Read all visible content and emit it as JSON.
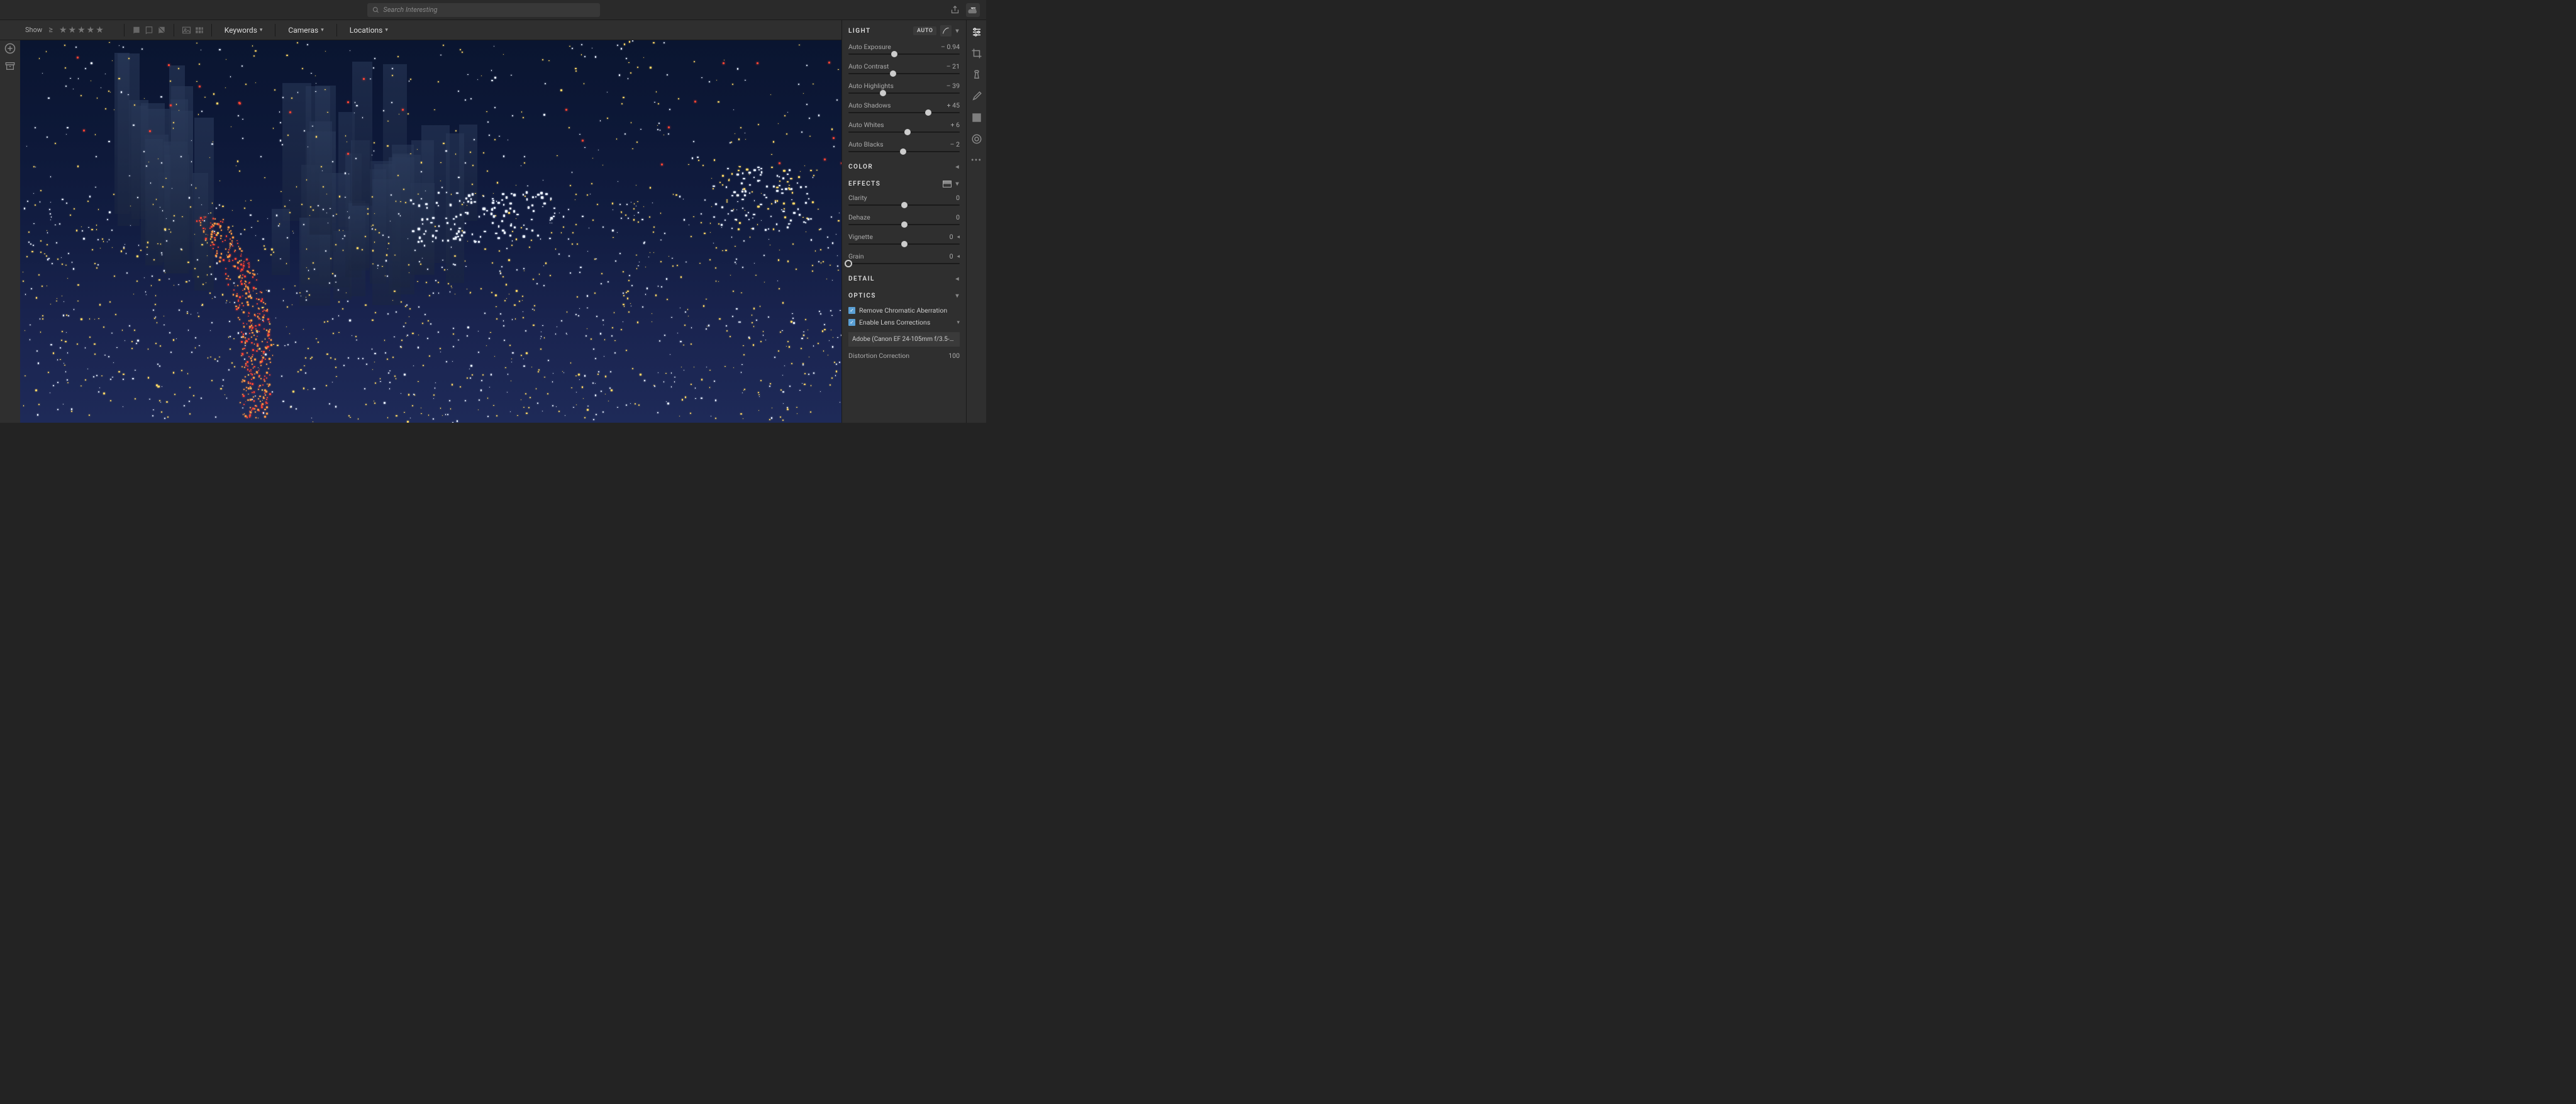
{
  "search": {
    "placeholder": "Search Interesting"
  },
  "filterbar": {
    "show_label": "Show",
    "dropdowns": {
      "keywords": "Keywords",
      "cameras": "Cameras",
      "locations": "Locations"
    }
  },
  "panels": {
    "light": {
      "title": "LIGHT",
      "auto_label": "AUTO",
      "sliders": [
        {
          "label": "Auto Exposure",
          "value": "– 0.94",
          "pos": 41
        },
        {
          "label": "Auto Contrast",
          "value": "– 21",
          "pos": 40
        },
        {
          "label": "Auto Highlights",
          "value": "– 39",
          "pos": 31
        },
        {
          "label": "Auto Shadows",
          "value": "+ 45",
          "pos": 72
        },
        {
          "label": "Auto Whites",
          "value": "+ 6",
          "pos": 53
        },
        {
          "label": "Auto Blacks",
          "value": "– 2",
          "pos": 49
        }
      ]
    },
    "color": {
      "title": "COLOR"
    },
    "effects": {
      "title": "EFFECTS",
      "sliders": [
        {
          "label": "Clarity",
          "value": "0",
          "pos": 50
        },
        {
          "label": "Dehaze",
          "value": "0",
          "pos": 50
        },
        {
          "label": "Vignette",
          "value": "0",
          "pos": 50,
          "expandable": true
        },
        {
          "label": "Grain",
          "value": "0",
          "pos": 0,
          "expandable": true,
          "big": true
        }
      ]
    },
    "detail": {
      "title": "DETAIL"
    },
    "optics": {
      "title": "OPTICS",
      "chromatic": "Remove Chromatic Aberration",
      "lens_corrections": "Enable Lens Corrections",
      "lens_profile": "Adobe (Canon EF 24-105mm f/3.5-5.…",
      "distortion_label": "Distortion Correction",
      "distortion_value": "100"
    }
  }
}
